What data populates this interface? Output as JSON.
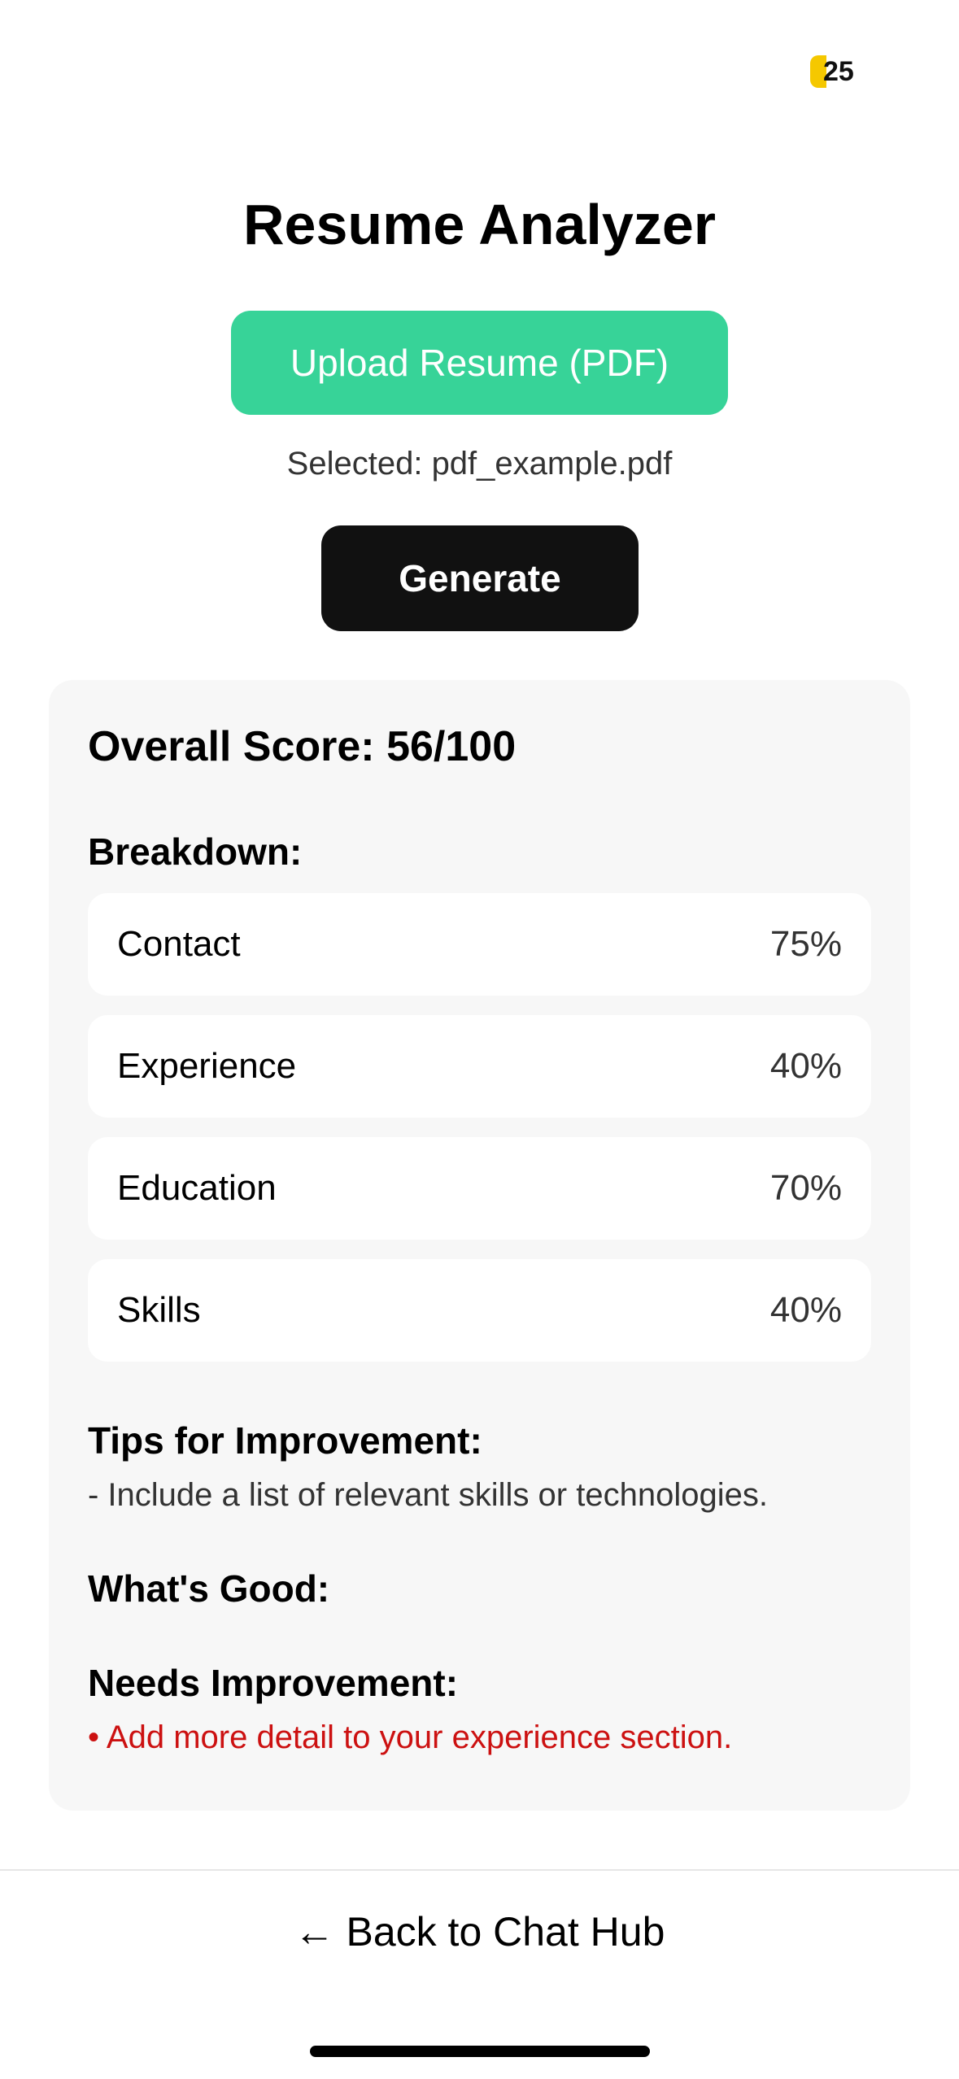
{
  "coins": {
    "count": "25",
    "icon": "coin-icon",
    "color": "#f5c800"
  },
  "title": "Resume Analyzer",
  "upload": {
    "label": "Upload Resume (PDF)",
    "color": "#37d398"
  },
  "selected_file": "Selected: pdf_example.pdf",
  "generate": {
    "label": "Generate"
  },
  "results": {
    "overall_score": "Overall Score: 56/100",
    "breakdown_heading": "Breakdown:",
    "breakdown": [
      {
        "label": "Contact",
        "value": "75%"
      },
      {
        "label": "Experience",
        "value": "40%"
      },
      {
        "label": "Education",
        "value": "70%"
      },
      {
        "label": "Skills",
        "value": "40%"
      }
    ],
    "tips_heading": "Tips for Improvement:",
    "tips": [
      "- Include a list of relevant skills or technologies."
    ],
    "good_heading": "What's Good:",
    "needs_heading": "Needs Improvement:",
    "needs": [
      "• Add more detail to your experience section."
    ],
    "needs_color": "#cc1111"
  },
  "back_link": "← Back to Chat Hub"
}
